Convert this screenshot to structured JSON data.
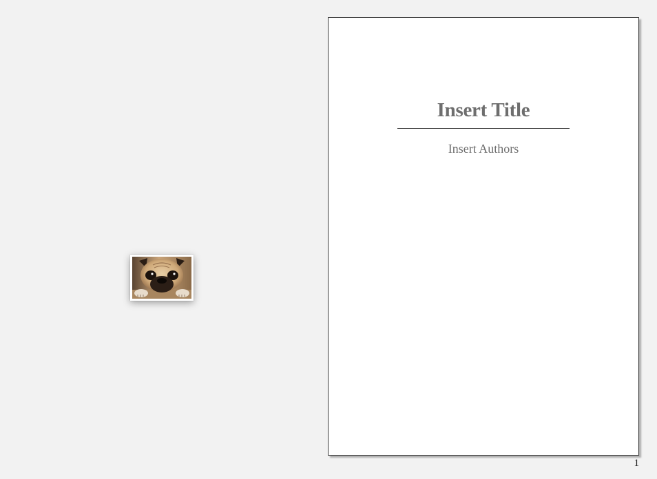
{
  "document": {
    "title": "Insert Title",
    "authors": "Insert Authors",
    "page_number": "1"
  },
  "thumbnail": {
    "icon": "pug-photo-icon"
  },
  "colors": {
    "background": "#f2f2f2",
    "page": "#ffffff",
    "text_muted": "#6e6e6e"
  }
}
